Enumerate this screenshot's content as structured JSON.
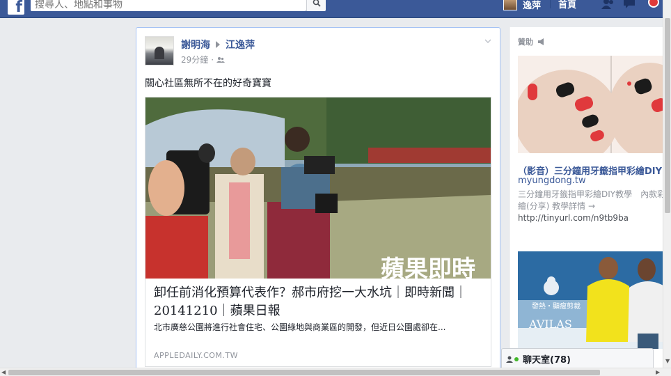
{
  "topbar": {
    "logo": "f",
    "search_placeholder": "搜尋人、地點和事物",
    "user_name": "逸萍",
    "home_label": "首頁"
  },
  "story": {
    "actor": "謝明海",
    "target": "江逸萍",
    "time": "29分鐘",
    "dot": "·",
    "message": "關心社區無所不在的好奇寶寶",
    "link": {
      "image_watermark": "蘋果即時",
      "title": "卸任前消化預算代表作？郝市府挖一大水坑｜即時新聞｜20141210｜蘋果日報",
      "description": "北市廣慈公園將進行社會住宅、公園綠地與商業區的開發，但近日公園處卻在...",
      "domain": "APPLEDAILY.COM.TW"
    }
  },
  "rail": {
    "sponsored_label": "贊助",
    "ad1": {
      "title": "（影音）三分鐘用牙籤指甲彩繪DIY",
      "domain": "myungdong.tw",
      "desc": "三分鐘用牙籤指甲彩繪DIY教學　內款彩繪(分享) 教學詳情 →",
      "url": "http://tinyurl.com/n9tb9ba"
    },
    "ad2": {
      "brand_line": "發熱・顯瘦剪裁",
      "brand": "AVILAS"
    }
  },
  "chat": {
    "label": "聊天室(78)"
  },
  "colors": {
    "brand": "#3b5998",
    "link": "#3b5998",
    "muted": "#90949c",
    "online": "#42b72a"
  },
  "icons": [
    "facebook-logo-icon",
    "search-icon",
    "friends-icon",
    "messages-icon",
    "notifications-icon",
    "people-audience-icon",
    "chevron-down-icon",
    "sponsored-megaphone-icon",
    "chat-icon"
  ]
}
